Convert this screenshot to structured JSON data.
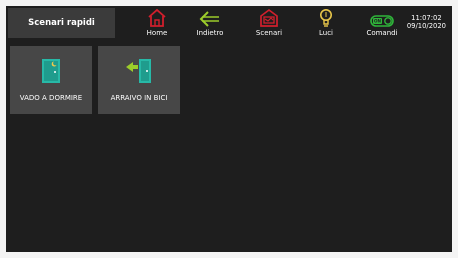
{
  "header": {
    "title": "Scenari rapidi",
    "clock": {
      "time": "11:07:02",
      "date": "09/10/2020"
    }
  },
  "nav": [
    {
      "label": "Home",
      "icon": "home-icon"
    },
    {
      "label": "Indietro",
      "icon": "back-arrow-icon"
    },
    {
      "label": "Scenari",
      "icon": "scenarios-icon"
    },
    {
      "label": "Luci",
      "icon": "lightbulb-icon"
    },
    {
      "label": "Comandi",
      "icon": "toggle-on-icon",
      "badge": "ON"
    }
  ],
  "tiles": [
    {
      "label": "VADO A DORMIRE",
      "icon": "door-moon-icon"
    },
    {
      "label": "ARRAIVO IN BICI",
      "icon": "door-enter-icon"
    }
  ],
  "colors": {
    "background": "#1e1e1e",
    "tile": "#474747",
    "header_title_bg": "#3b3b3b",
    "home": "#d11f2c",
    "back": "#9ccc2a",
    "scenari": "#d11f2c",
    "luci": "#e8c64a",
    "comandi": "#2fb53a",
    "teal": "#27b9a7"
  }
}
